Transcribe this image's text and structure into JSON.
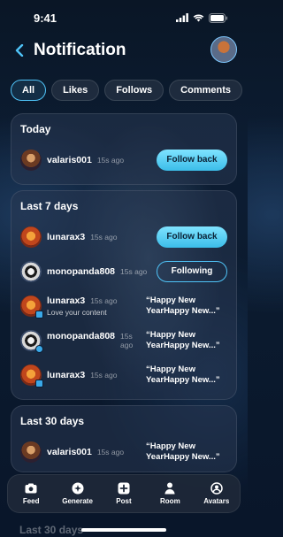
{
  "status": {
    "time": "9:41"
  },
  "header": {
    "title": "Notification"
  },
  "filters": [
    "All",
    "Likes",
    "Follows",
    "Comments"
  ],
  "sections": {
    "today": {
      "title": "Today",
      "rows": [
        {
          "user": "valaris001",
          "time": "15s ago",
          "action": "Follow back"
        }
      ]
    },
    "week": {
      "title": "Last 7 days",
      "rows": [
        {
          "user": "lunarax3",
          "time": "15s ago",
          "action": "Follow back"
        },
        {
          "user": "monopanda808",
          "time": "15s ago",
          "action": "Following"
        },
        {
          "user": "lunarax3",
          "time": "15s ago",
          "comment": "Love your content",
          "quote": "“Happy New YearHappy New...”"
        },
        {
          "user": "monopanda808",
          "time": "15s ago",
          "quote": "“Happy New YearHappy New...”"
        },
        {
          "user": "lunarax3",
          "time": "15s ago",
          "quote": "“Happy New YearHappy New...”"
        }
      ]
    },
    "month": {
      "title": "Last 30 days",
      "rows": [
        {
          "user": "valaris001",
          "time": "15s ago",
          "quote": "“Happy New YearHappy New...”"
        }
      ]
    },
    "peek_title": "Last 30 days"
  },
  "nav": [
    "Feed",
    "Generate",
    "Post",
    "Room",
    "Avatars"
  ]
}
